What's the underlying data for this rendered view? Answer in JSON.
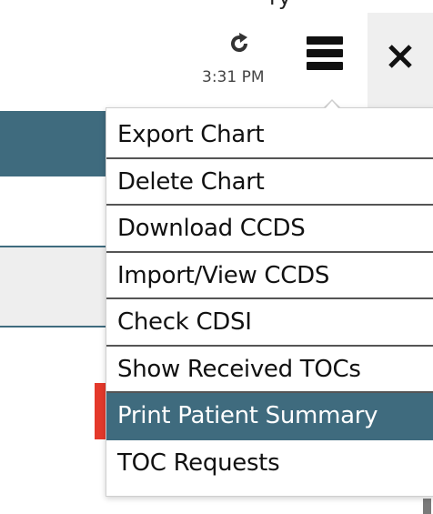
{
  "header": {
    "top_clip_text": "ry",
    "time": "3:31 PM",
    "refresh_icon": "refresh-icon",
    "menu_icon": "hamburger-menu-icon",
    "close_icon": "close-icon"
  },
  "menu": {
    "items": [
      {
        "label": "Export Chart"
      },
      {
        "label": "Delete Chart"
      },
      {
        "label": "Download CCDS"
      },
      {
        "label": "Import/View CCDS"
      },
      {
        "label": "Check CDSI"
      },
      {
        "label": "Show Received TOCs"
      },
      {
        "label": "Print Patient Summary"
      },
      {
        "label": "TOC Requests"
      }
    ],
    "active_index": 6
  },
  "colors": {
    "accent": "#3f6b7e",
    "alert": "#e4392b",
    "panel": "#efefef"
  }
}
